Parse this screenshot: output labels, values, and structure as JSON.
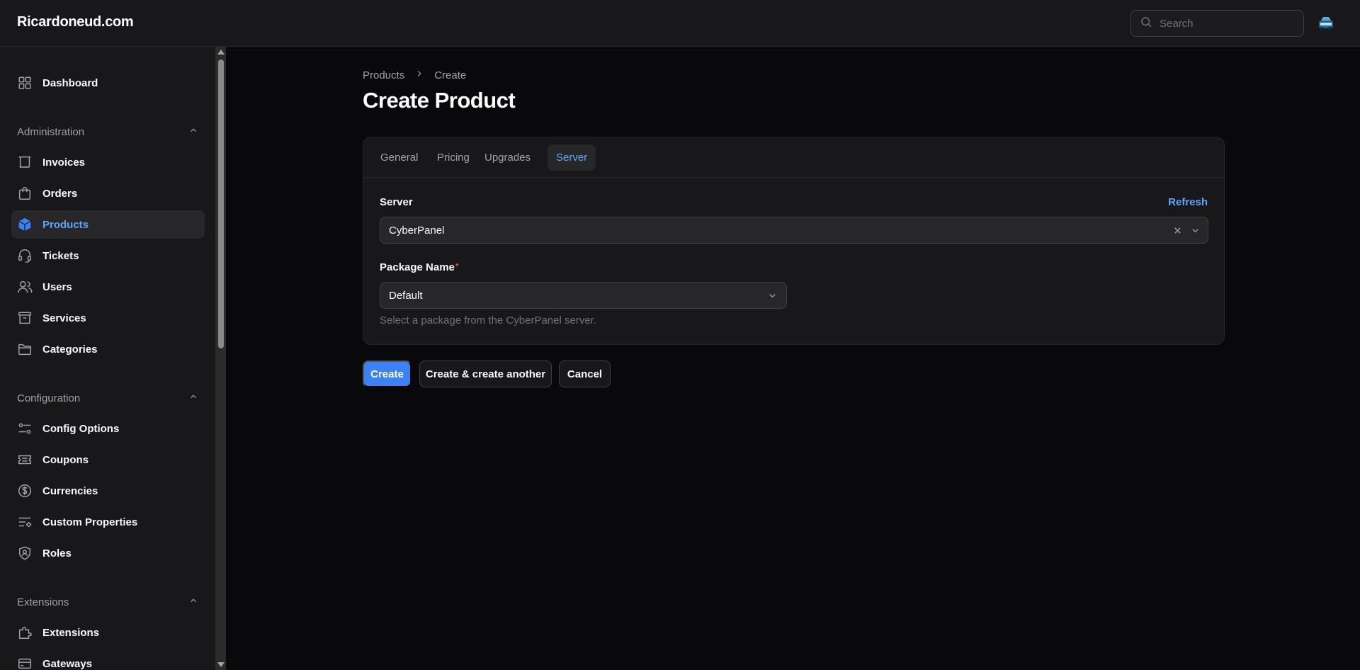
{
  "topbar": {
    "brand": "Ricardoneud.com",
    "search_placeholder": "Search"
  },
  "sidebar": {
    "dashboard": "Dashboard",
    "groups": [
      {
        "label": "Administration",
        "items": [
          "Invoices",
          "Orders",
          "Products",
          "Tickets",
          "Users",
          "Services",
          "Categories"
        ]
      },
      {
        "label": "Configuration",
        "items": [
          "Config Options",
          "Coupons",
          "Currencies",
          "Custom Properties",
          "Roles"
        ]
      },
      {
        "label": "Extensions",
        "items": [
          "Extensions",
          "Gateways"
        ]
      }
    ],
    "active_item": "Products"
  },
  "breadcrumb": [
    "Products",
    "Create"
  ],
  "page_title": "Create Product",
  "tabs": [
    "General",
    "Pricing",
    "Upgrades",
    "Server"
  ],
  "active_tab": "Server",
  "form": {
    "server_label": "Server",
    "refresh_label": "Refresh",
    "server_value": "CyberPanel",
    "package_label": "Package Name",
    "required_mark": "*",
    "package_value": "Default",
    "package_helper": "Select a package from the CyberPanel server."
  },
  "buttons": {
    "create": "Create",
    "create_another": "Create & create another",
    "cancel": "Cancel"
  },
  "colors": {
    "accent": "#3b82f6",
    "accent_text": "#60a5fa",
    "background": "#09090b",
    "panel": "#18181b",
    "required": "#ef4444"
  }
}
